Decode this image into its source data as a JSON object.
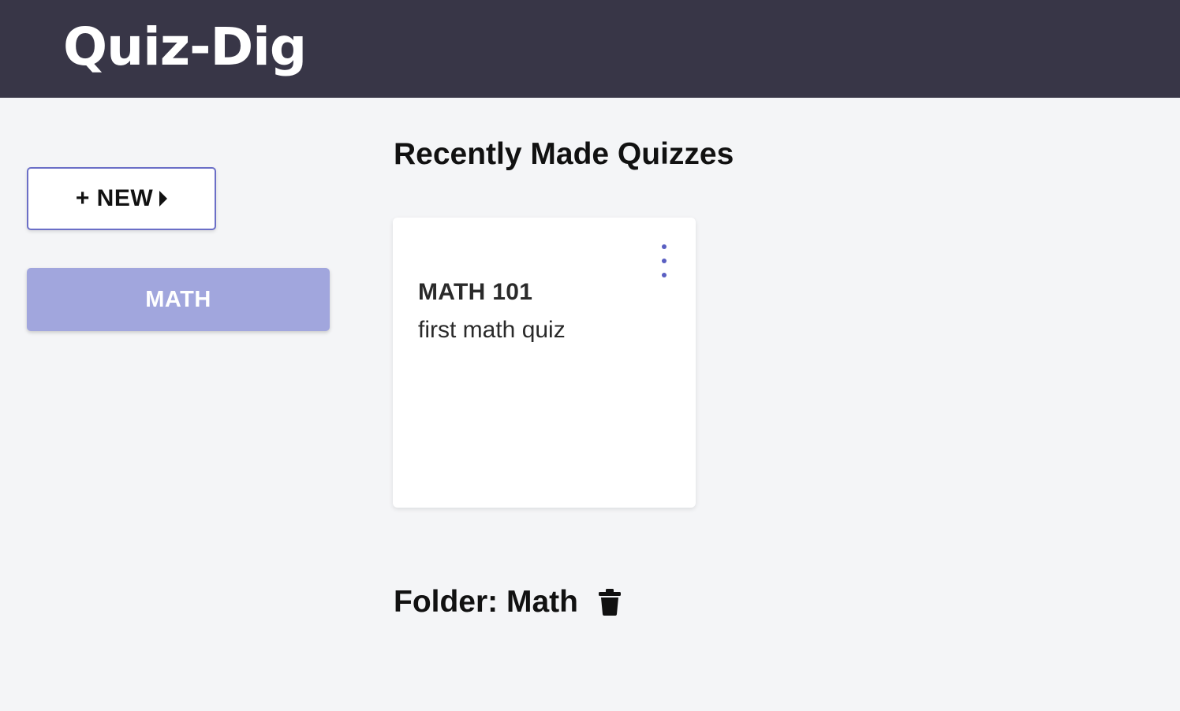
{
  "header": {
    "logo_text": "Quiz-Dig"
  },
  "sidebar": {
    "new_button": {
      "label": "+ NEW",
      "icon": "caret-right-icon"
    },
    "folders": [
      {
        "label": "MATH"
      }
    ]
  },
  "main": {
    "recent_title": "Recently Made Quizzes",
    "quizzes": [
      {
        "title": "MATH 101",
        "description": "first math quiz",
        "menu_icon": "more-vertical-icon"
      }
    ],
    "folder_heading": "Folder: Math",
    "folder_delete_icon": "trash-icon"
  },
  "colors": {
    "header_bg": "#383647",
    "page_bg": "#f4f5f7",
    "accent": "#6b6fc7",
    "folder_button_bg": "#a1a6dd"
  }
}
